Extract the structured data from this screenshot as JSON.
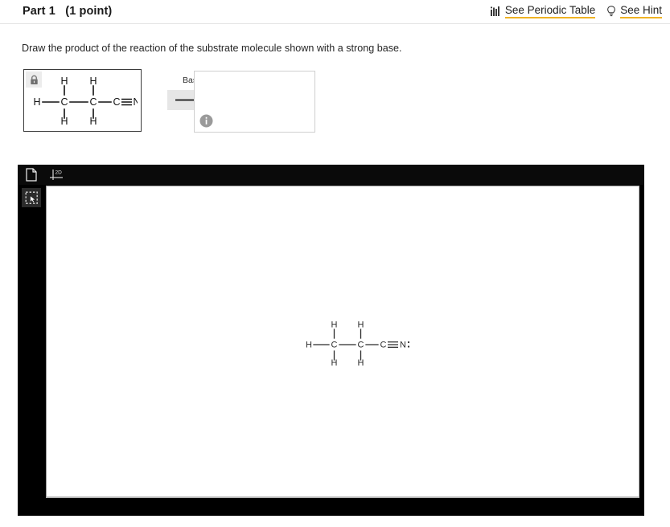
{
  "header": {
    "part_title": "Part 1   (1 point)",
    "links": [
      {
        "label": "See Periodic Table",
        "icon": "periodic-table-icon"
      },
      {
        "label": "See Hint",
        "icon": "lightbulb-icon"
      }
    ],
    "underline_color": "#f0b323"
  },
  "prompt": {
    "text": "Draw the product of the reaction of the substrate molecule shown with a strong base."
  },
  "reaction": {
    "substrate": {
      "locked": true,
      "lock_icon": "lock-icon",
      "name": "propanenitrile",
      "atoms": {
        "h_left": "H",
        "c1": "C",
        "c2": "C",
        "c3": "C",
        "n": "N",
        "h_top_left": "H",
        "h_top_right": "H",
        "h_bottom_left": "H",
        "h_bottom_right": "H",
        "lone_pair": ":"
      }
    },
    "arrow_label": "Base",
    "arrow_icon": "right-arrow-icon",
    "answer": {
      "value": "",
      "info_icon": "info-icon"
    }
  },
  "editor": {
    "toolbar": [
      {
        "name": "new-document-button",
        "icon": "document-icon"
      },
      {
        "name": "two-d-view-button",
        "icon": "2d-axes-icon",
        "label": "2D"
      }
    ],
    "tools": [
      {
        "name": "select-tool",
        "icon": "lasso-select-icon",
        "active": true
      }
    ],
    "canvas_molecule": {
      "name": "propanenitrile",
      "atoms": {
        "h_left": "H",
        "c1": "C",
        "c2": "C",
        "c3": "C",
        "n": "N",
        "h_top_left": "H",
        "h_top_right": "H",
        "h_bottom_left": "H",
        "h_bottom_right": "H",
        "lone_pair": ":"
      }
    }
  }
}
